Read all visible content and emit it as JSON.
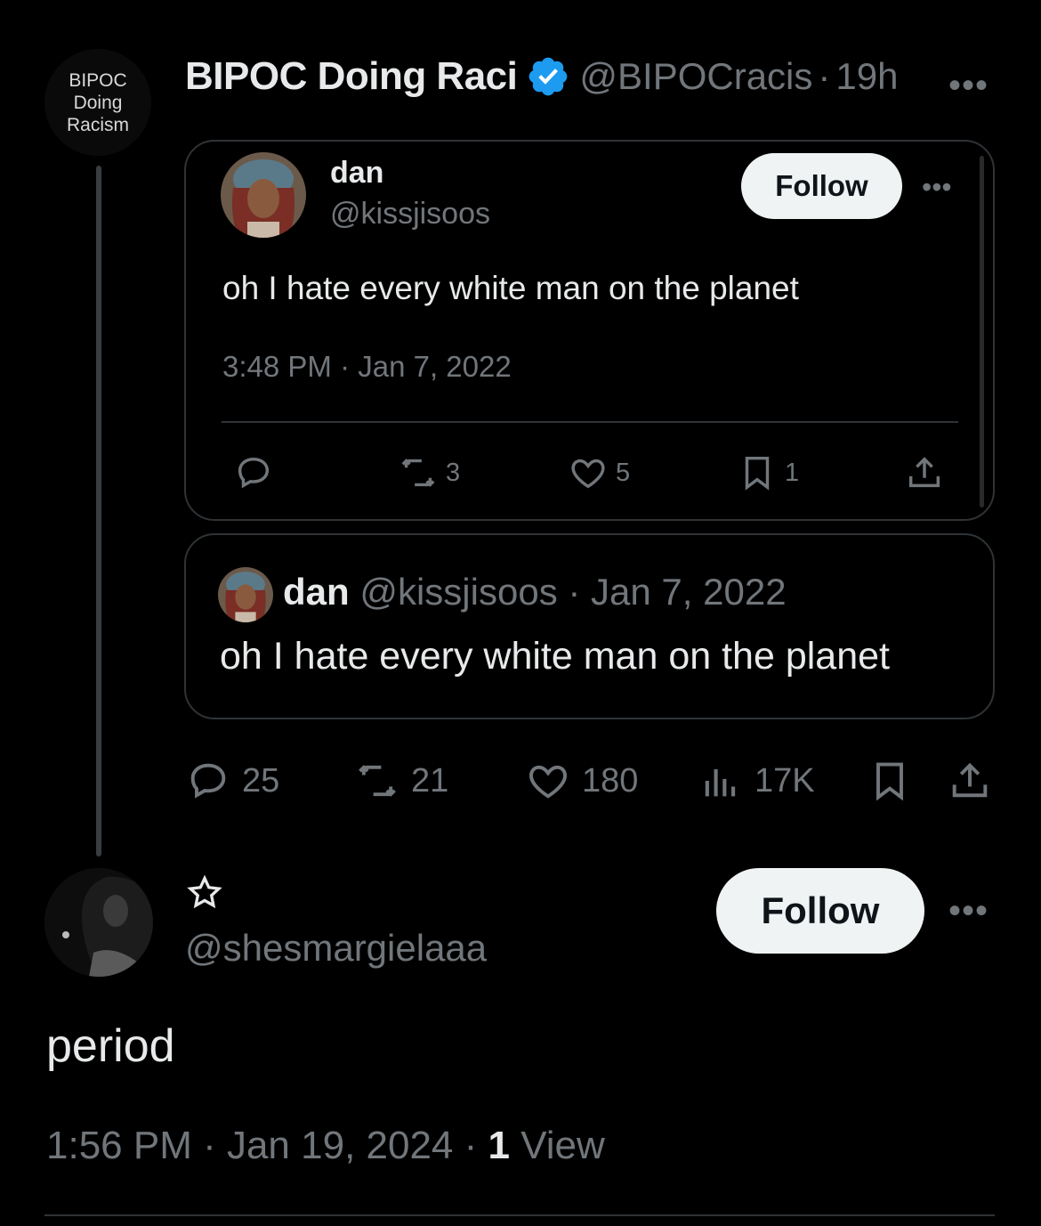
{
  "top_tweet": {
    "avatar_text": [
      "BIPOC",
      "Doing",
      "Racism"
    ],
    "display_name": "BIPOC Doing Raci",
    "handle": "@BIPOCracis",
    "separator": "·",
    "time": "19h",
    "more": "•••",
    "verified_color": "#1d9bf0",
    "quoted_tweet": {
      "display_name": "dan",
      "handle": "@kissjisoos",
      "follow_label": "Follow",
      "more": "•••",
      "text": "oh I hate every white man on the planet",
      "timestamp": "3:48 PM · Jan 7, 2022",
      "stats": {
        "reposts": "3",
        "likes": "5",
        "bookmarks": "1"
      }
    },
    "quote_card": {
      "display_name": "dan",
      "handle": "@kissjisoos",
      "meta": " · Jan 7, 2022",
      "text": "oh I hate every white man on the planet"
    },
    "actions": {
      "replies": "25",
      "reposts": "21",
      "likes": "180",
      "views": "17K"
    }
  },
  "reply_tweet": {
    "handle": "@shesmargielaaa",
    "follow_label": "Follow",
    "more": "•••",
    "text": "period",
    "time": "1:56 PM · Jan 19, 2024 · ",
    "views_count": "1",
    "views_label": " View"
  },
  "colors": {
    "background": "#000000",
    "text": "#e7e9ea",
    "muted": "#71767b",
    "border": "#2f3336",
    "verified": "#1d9bf0"
  }
}
